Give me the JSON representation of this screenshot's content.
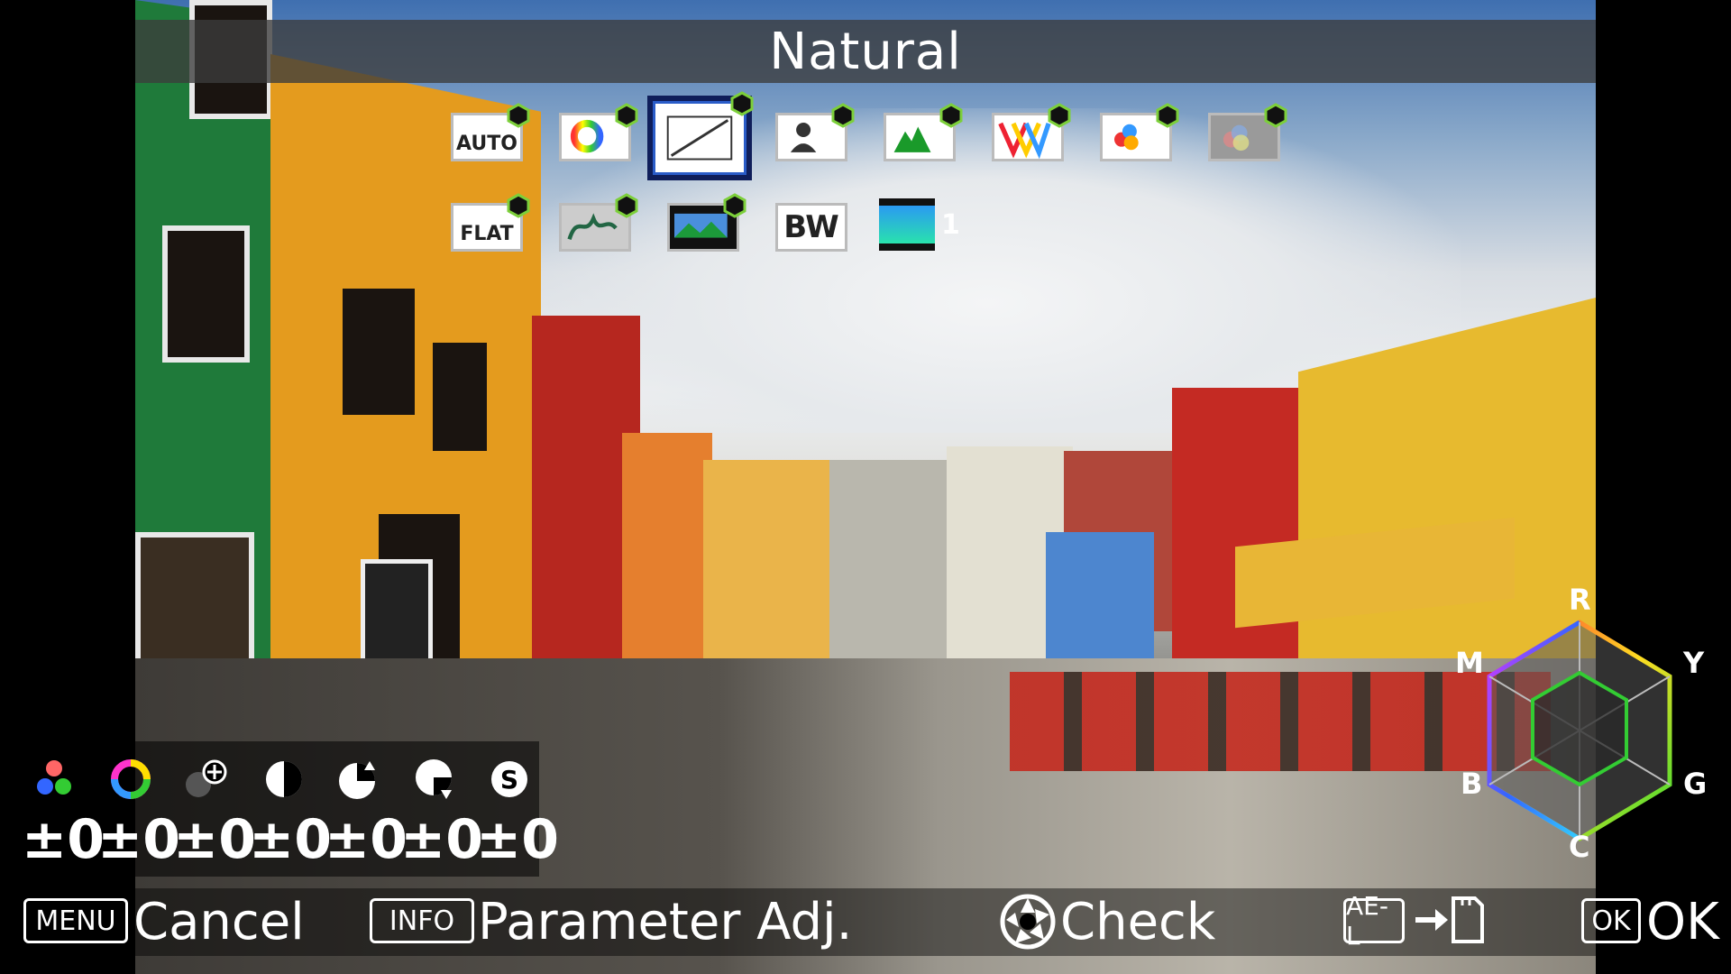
{
  "title": "Natural",
  "image_finish_icons": [
    {
      "name": "auto",
      "label": "AUTO"
    },
    {
      "name": "bright",
      "label": ""
    },
    {
      "name": "natural",
      "label": "",
      "selected": true
    },
    {
      "name": "portrait",
      "label": ""
    },
    {
      "name": "landscape",
      "label": ""
    },
    {
      "name": "vibrant",
      "label": ""
    },
    {
      "name": "radiant",
      "label": ""
    },
    {
      "name": "muted",
      "label": ""
    },
    {
      "name": "flat",
      "label": "FLAT"
    },
    {
      "name": "bleach-bypass",
      "label": ""
    },
    {
      "name": "reversal-film",
      "label": ""
    },
    {
      "name": "monochrome",
      "label": "BW"
    },
    {
      "name": "cross-processing",
      "label": "1"
    }
  ],
  "parameters": {
    "values": [
      "±0",
      "±0",
      "±0",
      "±0",
      "±0",
      "±0",
      "±0"
    ],
    "icons": [
      "saturation-icon",
      "hue-icon",
      "high-low-key-icon",
      "contrast-icon",
      "contrast-highlight-icon",
      "contrast-shadow-icon",
      "sharpness-icon"
    ]
  },
  "hex_chart": {
    "labels": {
      "r": "R",
      "y": "Y",
      "g": "G",
      "c": "C",
      "b": "B",
      "m": "M"
    }
  },
  "bottom_bar": {
    "menu_key": "MENU",
    "menu_label": "Cancel",
    "info_key": "INFO",
    "info_label": "Parameter Adj.",
    "check_label": "Check",
    "ael_key": "AE-L",
    "ok_key": "OK",
    "ok_label": "OK"
  }
}
